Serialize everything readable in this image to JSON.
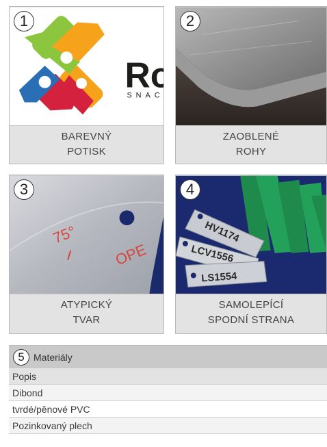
{
  "cards": [
    {
      "number": "1",
      "caption_line1": "BAREVNÝ",
      "caption_line2": "POTISK",
      "logo_text": "Ro",
      "logo_subtext": "SNAC"
    },
    {
      "number": "2",
      "caption_line1": "ZAOBLENÉ",
      "caption_line2": "ROHY"
    },
    {
      "number": "3",
      "caption_line1": "ATYPICKÝ",
      "caption_line2": "TVAR",
      "plate_text1": "75°",
      "plate_text2": "OPE"
    },
    {
      "number": "4",
      "caption_line1": "SAMOLEPÍCÍ",
      "caption_line2": "SPODNÍ STRANA",
      "tag1": "HV1174",
      "tag2": "LCV1556",
      "tag3": "LS1554"
    }
  ],
  "table": {
    "number": "5",
    "header": "Materiály",
    "subheader": "Popis",
    "rows": [
      "Dibond",
      "tvrdé/pěnové PVC",
      "Pozinkovaný plech"
    ]
  }
}
